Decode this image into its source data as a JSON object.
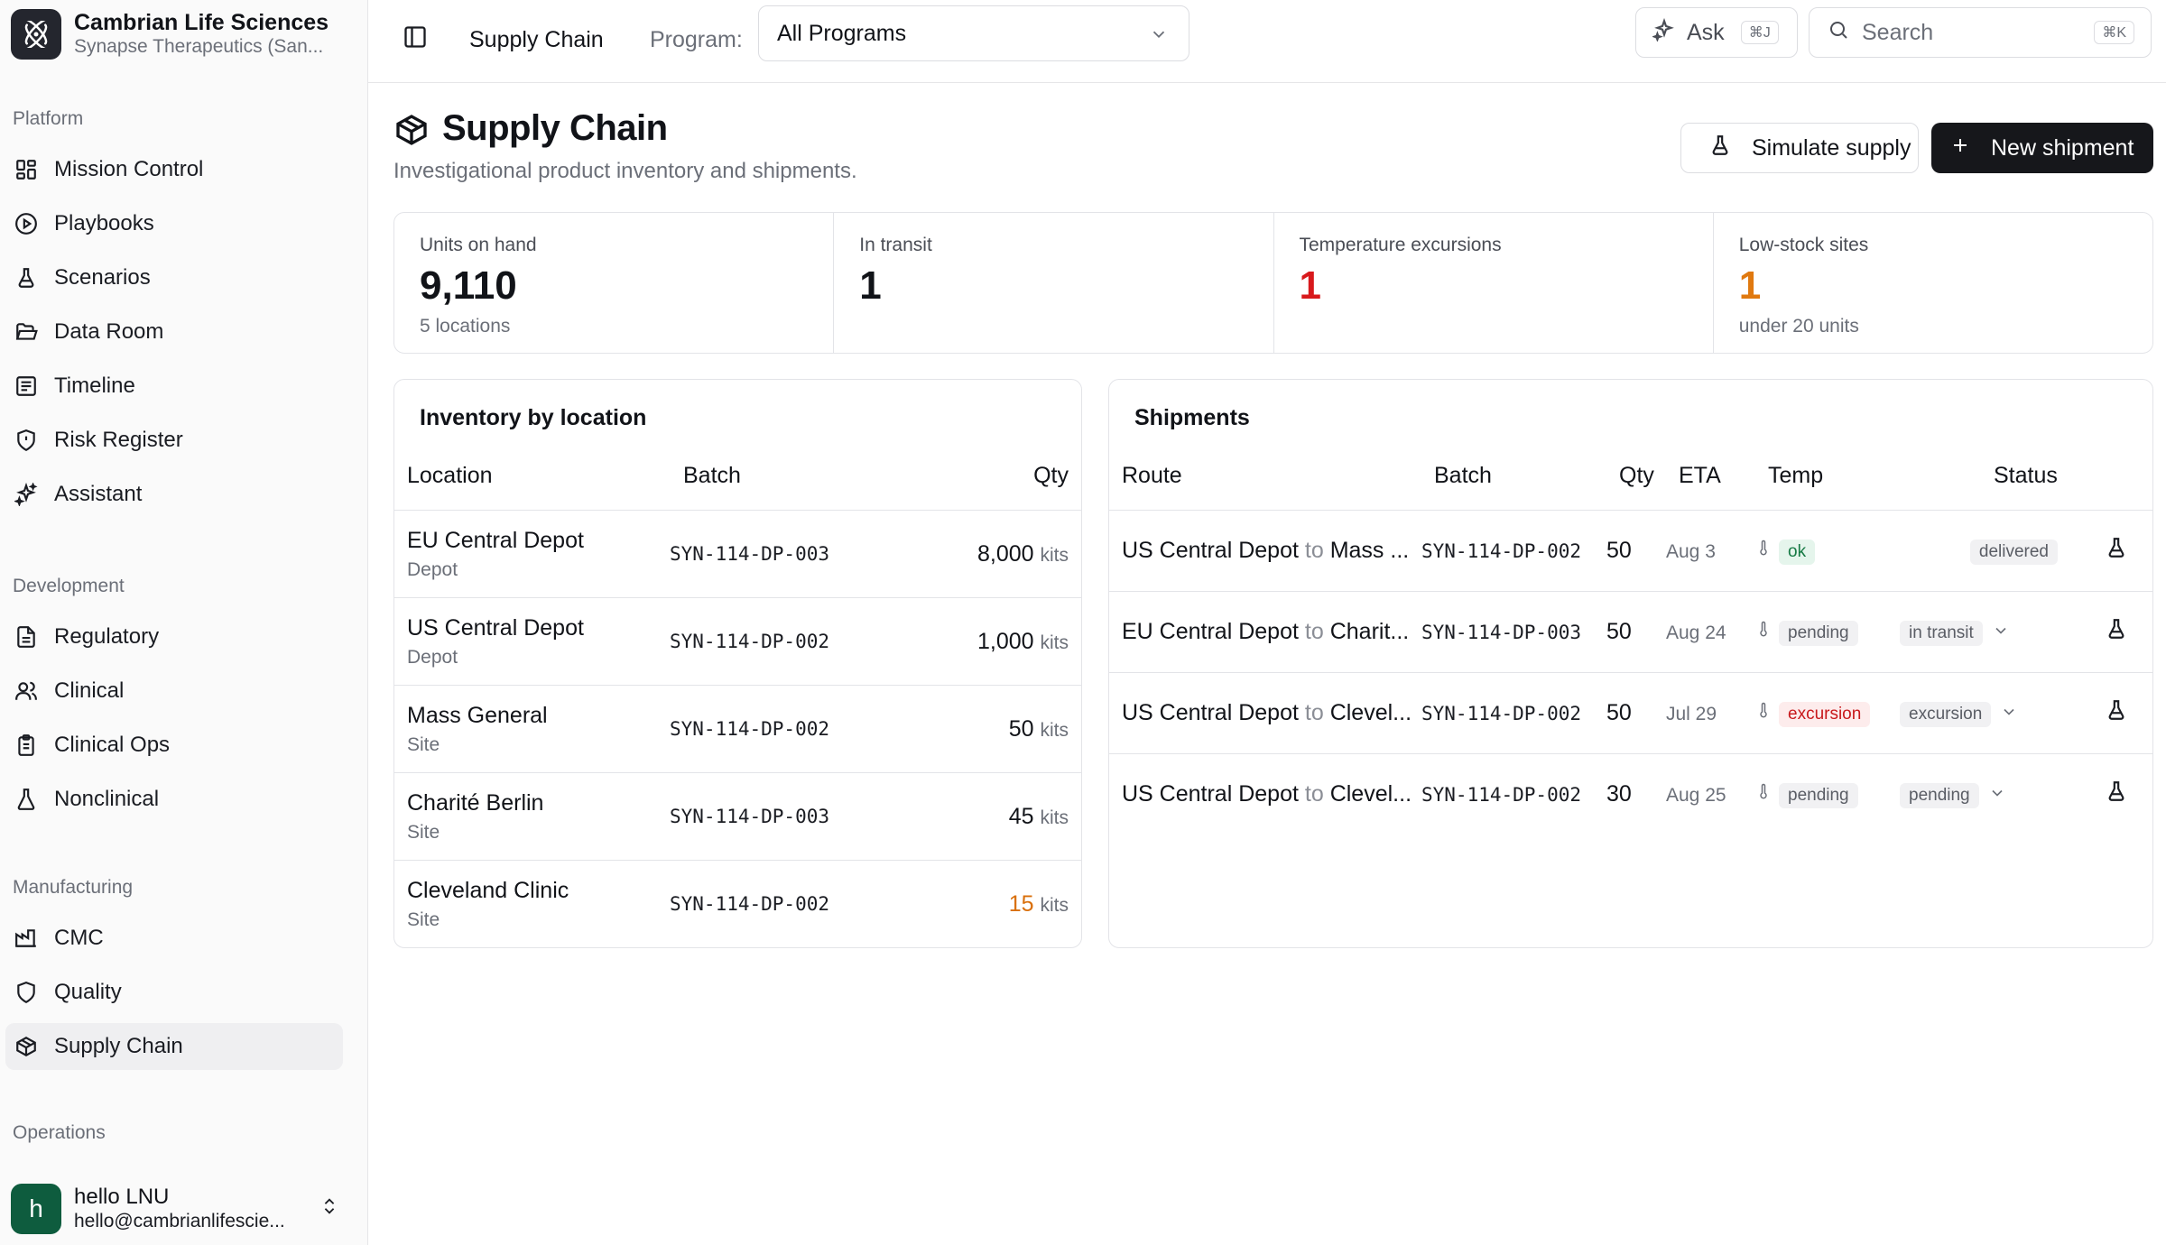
{
  "org": {
    "name": "Cambrian Life Sciences",
    "subtitle": "Synapse Therapeutics (San..."
  },
  "sidebar": {
    "sections": [
      {
        "label": "Platform",
        "items": [
          "Mission Control",
          "Playbooks",
          "Scenarios",
          "Data Room",
          "Timeline",
          "Risk Register",
          "Assistant"
        ]
      },
      {
        "label": "Development",
        "items": [
          "Regulatory",
          "Clinical",
          "Clinical Ops",
          "Nonclinical"
        ]
      },
      {
        "label": "Manufacturing",
        "items": [
          "CMC",
          "Quality",
          "Supply Chain"
        ]
      },
      {
        "label": "Operations",
        "items": []
      }
    ],
    "active_item": "Supply Chain"
  },
  "user": {
    "initial": "h",
    "name": "hello LNU",
    "email": "hello@cambrianlifescie..."
  },
  "topbar": {
    "breadcrumb": "Supply Chain",
    "program_label": "Program:",
    "program_value": "All Programs",
    "ask_label": "Ask",
    "ask_shortcut": "⌘J",
    "search_placeholder": "Search",
    "search_shortcut": "⌘K"
  },
  "page": {
    "title": "Supply Chain",
    "subtitle": "Investigational product inventory and shipments.",
    "simulate_label": "Simulate supply",
    "new_shipment_label": "New shipment"
  },
  "stats": [
    {
      "label": "Units on hand",
      "value": "9,110",
      "note": "5 locations",
      "color": "#111318"
    },
    {
      "label": "In transit",
      "value": "1",
      "note": "",
      "color": "#111318"
    },
    {
      "label": "Temperature excursions",
      "value": "1",
      "note": "",
      "color": "#d8191c"
    },
    {
      "label": "Low-stock sites",
      "value": "1",
      "note": "under 20 units",
      "color": "#e0790f"
    }
  ],
  "inventory": {
    "title": "Inventory by location",
    "headers": {
      "location": "Location",
      "batch": "Batch",
      "qty": "Qty"
    },
    "unit": "kits",
    "rows": [
      {
        "name": "EU Central Depot",
        "type": "Depot",
        "batch": "SYN-114-DP-003",
        "qty": "8,000",
        "low": false
      },
      {
        "name": "US Central Depot",
        "type": "Depot",
        "batch": "SYN-114-DP-002",
        "qty": "1,000",
        "low": false
      },
      {
        "name": "Mass General",
        "type": "Site",
        "batch": "SYN-114-DP-002",
        "qty": "50",
        "low": false
      },
      {
        "name": "Charité Berlin",
        "type": "Site",
        "batch": "SYN-114-DP-003",
        "qty": "45",
        "low": false
      },
      {
        "name": "Cleveland Clinic",
        "type": "Site",
        "batch": "SYN-114-DP-002",
        "qty": "15",
        "low": true
      }
    ]
  },
  "shipments": {
    "title": "Shipments",
    "headers": {
      "route": "Route",
      "batch": "Batch",
      "qty": "Qty",
      "eta": "ETA",
      "temp": "Temp",
      "status": "Status"
    },
    "to_word": "to",
    "rows": [
      {
        "from": "US Central Depot",
        "dest": "Mass ...",
        "batch": "SYN-114-DP-002",
        "qty": "50",
        "eta": "Aug 3",
        "temp": "ok",
        "temp_kind": "ok",
        "status": "delivered",
        "editable": false
      },
      {
        "from": "EU Central Depot",
        "dest": "Charit...",
        "batch": "SYN-114-DP-003",
        "qty": "50",
        "eta": "Aug 24",
        "temp": "pending",
        "temp_kind": "pending",
        "status": "in transit",
        "editable": true
      },
      {
        "from": "US Central Depot",
        "dest": "Clevel...",
        "batch": "SYN-114-DP-002",
        "qty": "50",
        "eta": "Jul 29",
        "temp": "excursion",
        "temp_kind": "excursion",
        "status": "excursion",
        "editable": true
      },
      {
        "from": "US Central Depot",
        "dest": "Clevel...",
        "batch": "SYN-114-DP-002",
        "qty": "30",
        "eta": "Aug 25",
        "temp": "pending",
        "temp_kind": "pending",
        "status": "pending",
        "editable": true
      }
    ]
  }
}
